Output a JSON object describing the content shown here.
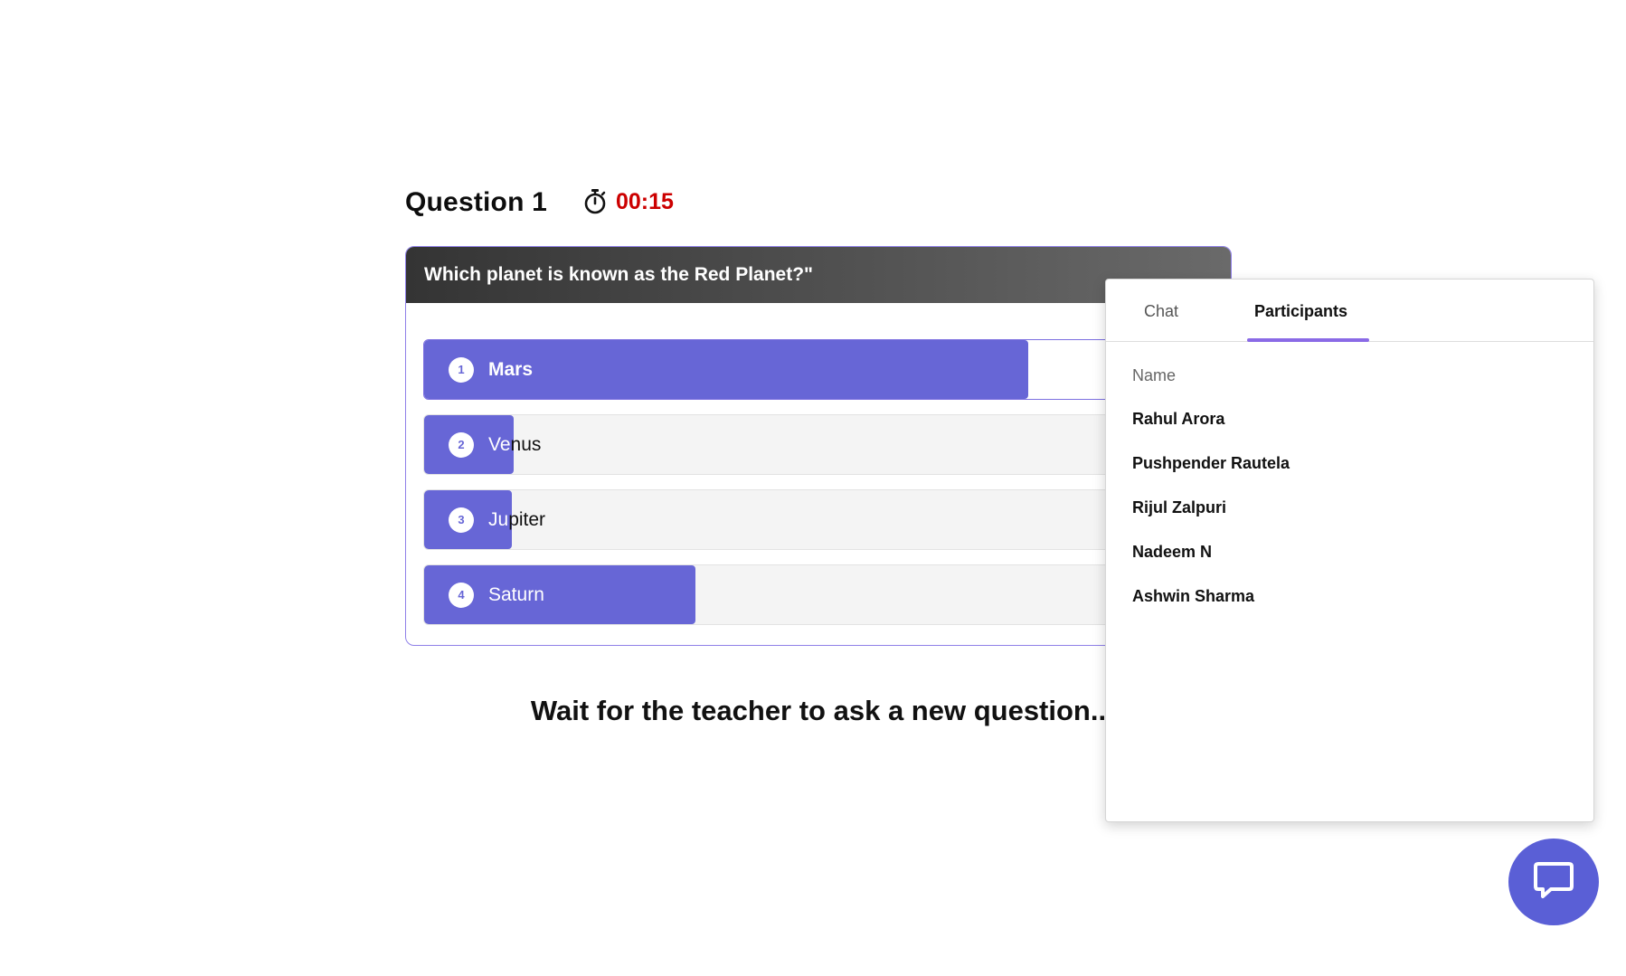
{
  "question": {
    "title": "Question 1",
    "timer": "00:15",
    "text": "Which planet is known as the Red Planet?\"",
    "options": [
      {
        "number": "1",
        "label": "Mars",
        "selected": true,
        "fill_fraction": 0.66
      },
      {
        "number": "2",
        "label": "Venus",
        "selected": false,
        "fill_fraction": 0.1
      },
      {
        "number": "3",
        "label": "Jupiter",
        "selected": false,
        "fill_fraction": 0.1
      },
      {
        "number": "4",
        "label": "Saturn",
        "selected": false,
        "fill_fraction": 0.3
      }
    ]
  },
  "wait_message": "Wait for the teacher to ask a new question..",
  "panel": {
    "tabs": [
      "Chat",
      "Participants"
    ],
    "active_tab": "Participants",
    "column_header": "Name",
    "participants": [
      "Rahul Arora",
      "Pushpender Rautela",
      "Rijul Zalpuri",
      "Nadeem N",
      "Ashwin Sharma"
    ]
  },
  "icons": {
    "timer": "stopwatch-icon",
    "fab": "chat-bubble-icon"
  },
  "colors": {
    "accent": "#6766d6",
    "timer": "#cc0000",
    "tab_underline": "#8a6ae6",
    "fab": "#5a5fd6"
  }
}
